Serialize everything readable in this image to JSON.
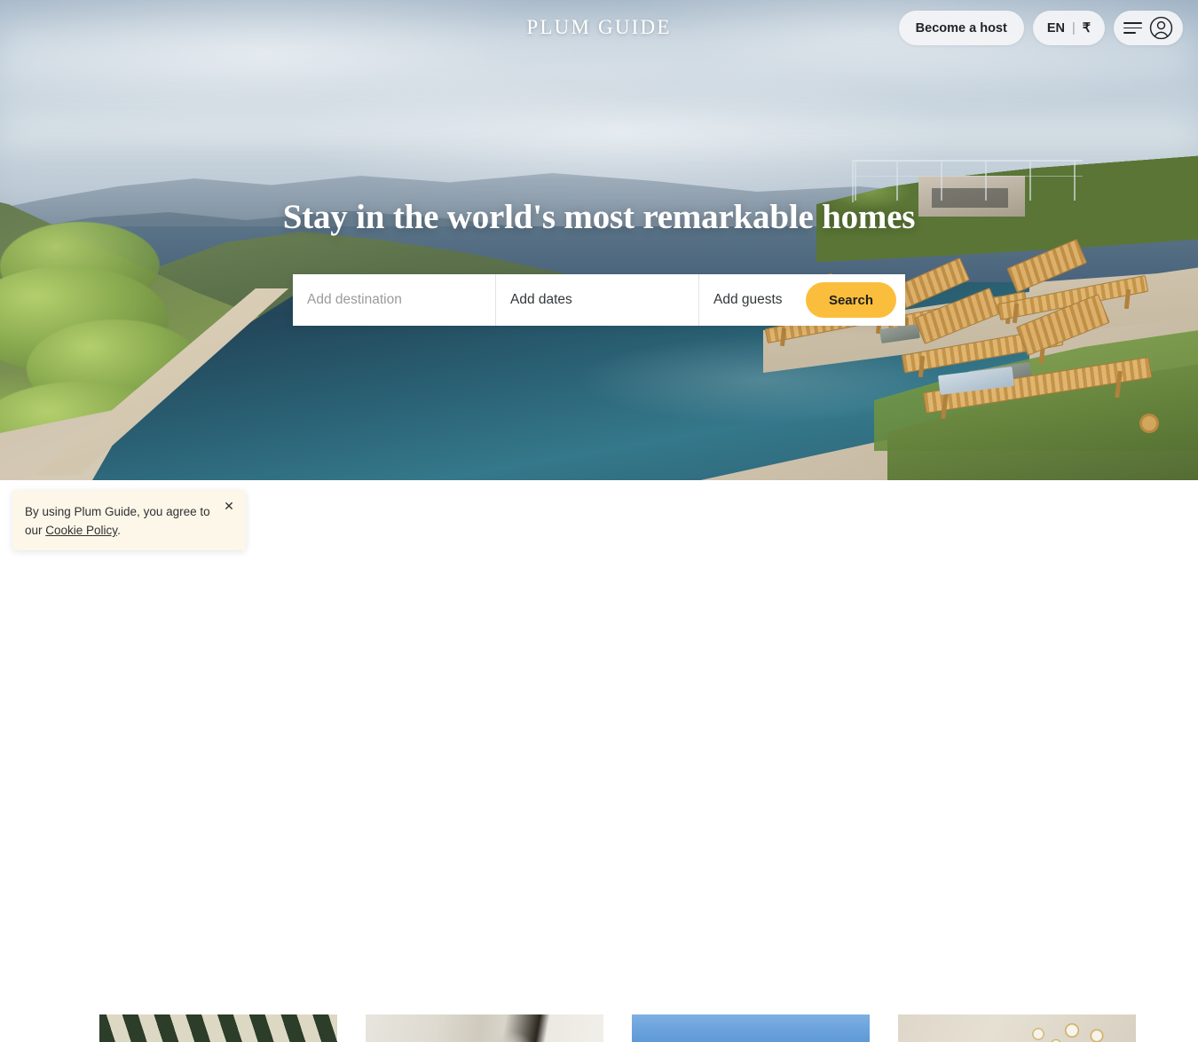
{
  "header": {
    "logo": "PLUM GUIDE",
    "become_host_label": "Become a host",
    "language": "EN",
    "separator": "|",
    "currency": "₹",
    "menu_icon": "hamburger-icon",
    "avatar_icon": "user-avatar-icon"
  },
  "hero": {
    "headline": "Stay in the world's most remarkable homes",
    "search": {
      "destination_placeholder": "Add destination",
      "destination_value": "",
      "dates_label": "Add dates",
      "guests_label": "Add guests",
      "search_button": "Search"
    }
  },
  "cards": [
    {
      "name": "striped-awning-card",
      "alt": "Green and cream striped awning"
    },
    {
      "name": "bathroom-card",
      "alt": "Light bathroom interior"
    },
    {
      "name": "blue-sky-card",
      "alt": "Blue sky"
    },
    {
      "name": "pendant-lights-card",
      "alt": "Gold pendant lights"
    }
  ],
  "cookie": {
    "text_before": "By using Plum Guide, you agree to our ",
    "link_label": "Cookie Policy",
    "text_after": ".",
    "close_icon": "close-icon"
  },
  "colors": {
    "search_button": "#FBBE3C",
    "cookie_background": "#FDF7E9",
    "pill_background": "#F3F4F6",
    "text_dark": "#1F2326",
    "placeholder": "#9B9B9B"
  }
}
